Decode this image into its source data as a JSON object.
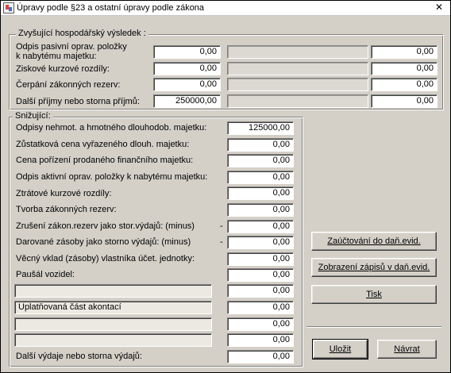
{
  "window": {
    "title": "Úpravy podle §23 a ostatní úpravy podle zákona",
    "close_glyph": "✕"
  },
  "increase_group": {
    "title": "Zvyšující hospodářský výsledek :",
    "rows": [
      {
        "label_line1": "Odpis pasivní oprav. položky",
        "label_line2": "k nabytému majetku:",
        "value": "0,00",
        "extra": "",
        "value2": "0,00"
      },
      {
        "label": "Ziskové kurzové rozdíly:",
        "value": "0,00",
        "extra": "",
        "value2": "0,00"
      },
      {
        "label": "Čerpání zákonných rezerv:",
        "value": "0,00",
        "extra": "",
        "value2": "0,00"
      },
      {
        "label": "Další příjmy nebo storna příjmů:",
        "value": "250000,00",
        "extra": "",
        "value2": "0,00"
      }
    ]
  },
  "decrease_group": {
    "title": "Snižující:",
    "rows": [
      {
        "label": "Odpisy nehmot. a hmotného dlouhodob. majetku:",
        "value": "125000,00"
      },
      {
        "label": "Zůstatková cena vyřazeného dlouh. majetku:",
        "value": "0,00"
      },
      {
        "label": "Cena pořízení prodaného finančního majetku:",
        "value": "0,00"
      },
      {
        "label": "Odpis aktivní oprav. položky k nabytému majetku:",
        "value": "0,00"
      },
      {
        "label": "Ztrátové kurzové rozdíly:",
        "value": "0,00"
      },
      {
        "label": "Tvorba zákonných rezerv:",
        "value": "0,00"
      },
      {
        "label": "Zrušení zákon.rezerv jako stor.výdajů: (minus)",
        "minus": "-",
        "value": "0,00"
      },
      {
        "label": "Darované zásoby jako storno výdajů: (minus)",
        "minus": "-",
        "value": "0,00"
      },
      {
        "label": "Věcný vklad (zásoby) vlastníka účet. jednotky:",
        "value": "0,00"
      },
      {
        "label": "Paušál vozidel:",
        "value": "0,00"
      }
    ],
    "custom_rows": [
      {
        "caption": "",
        "value": "0,00"
      },
      {
        "caption": "Uplatňovaná část akontací",
        "value": "0,00"
      },
      {
        "caption": "",
        "value": "0,00"
      },
      {
        "caption": "",
        "value": "0,00"
      }
    ],
    "last_row": {
      "label": "Další výdaje nebo storna výdajů:",
      "value": "0,00"
    }
  },
  "buttons": {
    "post_to_records_prefix": "Zaúčtování do daň.evid.",
    "show_records": "Zobrazení zápisů v daň.evid.",
    "print": "Tisk",
    "save": "Uložit",
    "back": "Návrat"
  }
}
